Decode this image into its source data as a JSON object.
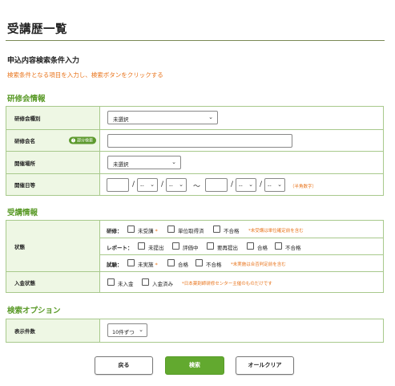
{
  "page": {
    "title": "受講歴一覧",
    "sub_heading": "申込内容検索条件入力",
    "instruction": "検索条件となる項目を入力し、検索ボタンをクリックする"
  },
  "colors": {
    "accent_green": "#62a92f",
    "section_green": "#5a9a28",
    "note_orange": "#e8731a",
    "label_bg": "#eef7e4",
    "border_green": "#a8c98c"
  },
  "training_section": {
    "title": "研修会情報",
    "type_label": "研修会種別",
    "type_value": "未選択",
    "name_label": "研修会名",
    "partial_badge": "部分検索",
    "name_value": "",
    "location_label": "開催場所",
    "location_value": "未選択",
    "date_label": "開催日等",
    "date_from": {
      "year": "",
      "month": "--",
      "day": "--"
    },
    "date_to": {
      "year": "",
      "month": "--",
      "day": "--"
    },
    "slash": "/",
    "tilde": "〜",
    "date_note": "（半角数字）"
  },
  "attendance_section": {
    "title": "受講情報",
    "status_label": "状態",
    "training_sub_label": "研修：",
    "training_options": [
      "未受講",
      "単位取得済",
      "不合格"
    ],
    "required_mark": "*",
    "training_note": "*未受講は単位確定前を含む",
    "report_sub_label": "レポート：",
    "report_options": [
      "未提出",
      "評価中",
      "要再提出",
      "合格",
      "不合格"
    ],
    "exam_sub_label": "試験：",
    "exam_options": [
      "未実施",
      "合格",
      "不合格"
    ],
    "exam_note": "*未実施は合否判定前を含む",
    "payment_label": "入金状態",
    "payment_options": [
      "未入金",
      "入金済み"
    ],
    "payment_note": "*日本薬剤師研修センター主催のものだけです"
  },
  "search_options_section": {
    "title": "検索オプション",
    "count_label": "表示件数",
    "count_value": "10件ずつ"
  },
  "buttons": {
    "back": "戻る",
    "search": "検索",
    "clear_all": "オールクリア"
  },
  "icons": {
    "select_chevron": "chevron-down-icon",
    "badge_icon": "search-info-icon"
  }
}
